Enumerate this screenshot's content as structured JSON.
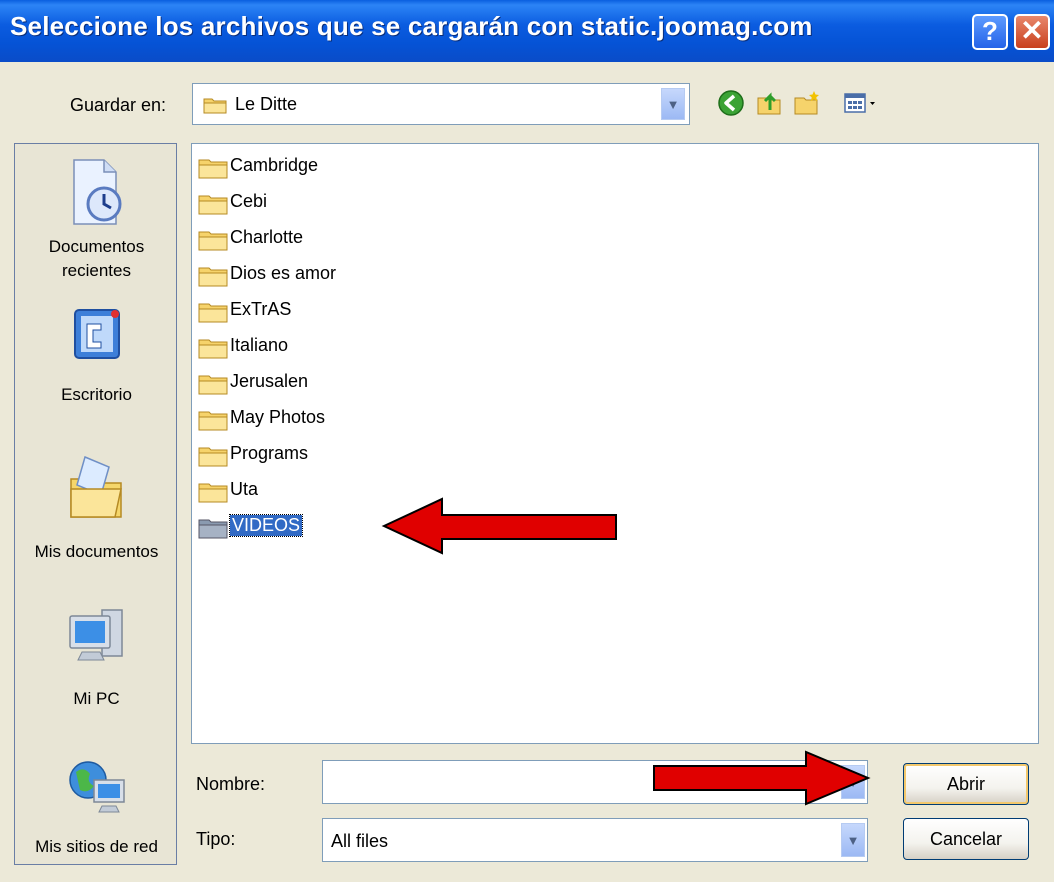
{
  "window": {
    "title": "Seleccione los archivos que se cargarán con static.joomag.com",
    "help_glyph": "?",
    "close_glyph": "✕"
  },
  "lookin": {
    "label": "Guardar en:",
    "value": "Le Ditte"
  },
  "toolbar": {
    "icons": [
      "back-icon",
      "up-folder-icon",
      "new-folder-icon",
      "view-menu-icon"
    ]
  },
  "places": [
    {
      "label_line1": "Documentos",
      "label_line2": "recientes",
      "icon": "recent-documents-icon"
    },
    {
      "label_line1": "Escritorio",
      "label_line2": "",
      "icon": "desktop-icon"
    },
    {
      "label_line1": "Mis documentos",
      "label_line2": "",
      "icon": "my-documents-icon"
    },
    {
      "label_line1": "Mi PC",
      "label_line2": "",
      "icon": "my-computer-icon"
    },
    {
      "label_line1": "Mis sitios de red",
      "label_line2": "",
      "icon": "network-places-icon"
    }
  ],
  "files": [
    {
      "name": "Cambridge",
      "selected": false
    },
    {
      "name": "Cebi",
      "selected": false
    },
    {
      "name": "Charlotte",
      "selected": false
    },
    {
      "name": "Dios es amor",
      "selected": false
    },
    {
      "name": "ExTrAS",
      "selected": false
    },
    {
      "name": "Italiano",
      "selected": false
    },
    {
      "name": "Jerusalen",
      "selected": false
    },
    {
      "name": "May Photos",
      "selected": false
    },
    {
      "name": "Programs",
      "selected": false
    },
    {
      "name": "Uta",
      "selected": false
    },
    {
      "name": "VIDEOS",
      "selected": true
    }
  ],
  "fields": {
    "name_label": "Nombre:",
    "name_value": "",
    "type_label": "Tipo:",
    "type_value": "All files"
  },
  "buttons": {
    "open": "Abrir",
    "cancel": "Cancelar"
  },
  "colors": {
    "titlebar": "#0A5FDF",
    "selection": "#316AC5",
    "annotation_arrow": "#E00000"
  }
}
